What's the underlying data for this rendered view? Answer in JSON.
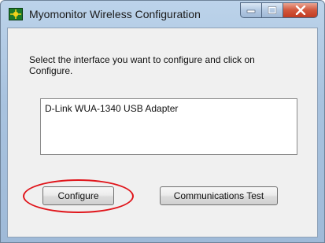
{
  "window": {
    "title": "Myomonitor Wireless Configuration",
    "icon": "myomonitor-app-icon",
    "caption_buttons": [
      "minimize-icon",
      "maximize-icon",
      "close-icon"
    ]
  },
  "instruction": "Select the interface you want to configure and click on Configure.",
  "interfaces": {
    "items": [
      "D-Link WUA-1340 USB Adapter"
    ]
  },
  "buttons": {
    "configure": "Configure",
    "communications_test": "Communications Test"
  },
  "colors": {
    "highlight": "#e0151b",
    "close_button": "#c13c22"
  }
}
